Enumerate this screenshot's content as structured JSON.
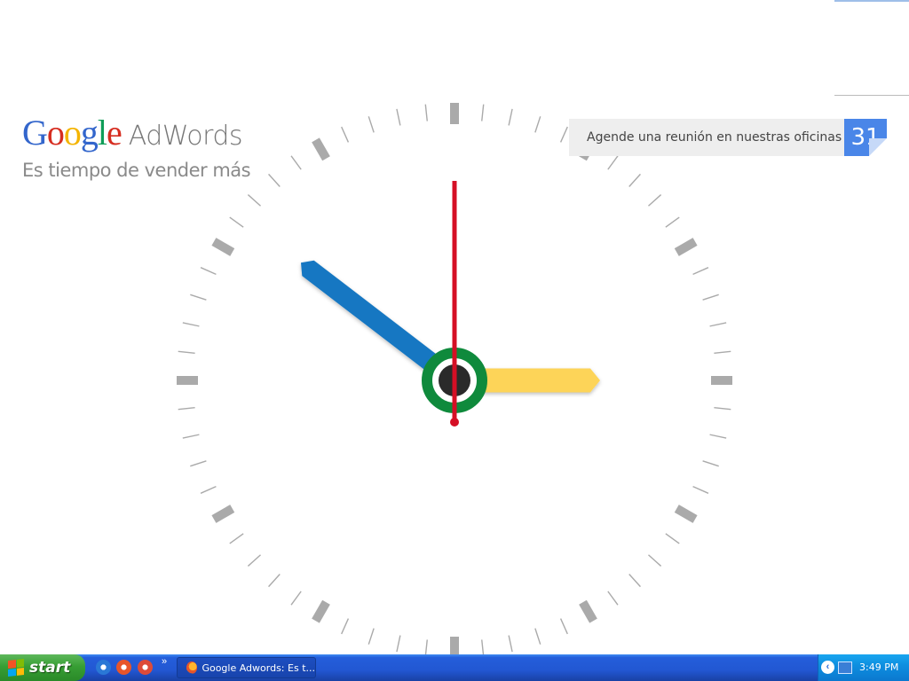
{
  "brand": {
    "logo_letters": [
      {
        "ch": "G",
        "color": "#3366cc"
      },
      {
        "ch": "o",
        "color": "#d62d20"
      },
      {
        "ch": "o",
        "color": "#f4b400"
      },
      {
        "ch": "g",
        "color": "#3366cc"
      },
      {
        "ch": "l",
        "color": "#0f9d58"
      },
      {
        "ch": "e",
        "color": "#d62d20"
      }
    ],
    "logo_text": "Google",
    "product": "AdWords",
    "tagline": "Es tiempo de vender más"
  },
  "cta": {
    "label": "Agende una reunión en nuestras oficinas",
    "calendar_day": "31",
    "icon": "calendar-icon"
  },
  "clock": {
    "time_shown": {
      "hour": 10,
      "minute": 15,
      "second": 0
    },
    "colors": {
      "hour_hand": "#1577c2",
      "minute_hand": "#fdd458",
      "second_hand": "#d50f25",
      "center_ring": "#0f8a3c",
      "center_hub": "#2a2a2a",
      "ticks": "#aaaaaa"
    }
  },
  "taskbar": {
    "start_label": "start",
    "quick_launch": [
      {
        "name": "internet-explorer-icon",
        "color": "#2a78d6"
      },
      {
        "name": "firefox-icon",
        "color": "#e7552a"
      },
      {
        "name": "chrome-icon",
        "color": "#dd4b39"
      }
    ],
    "more_label": "»",
    "task_button_label": "Google Adwords: Es t...",
    "tray_time": "3:49 PM"
  }
}
